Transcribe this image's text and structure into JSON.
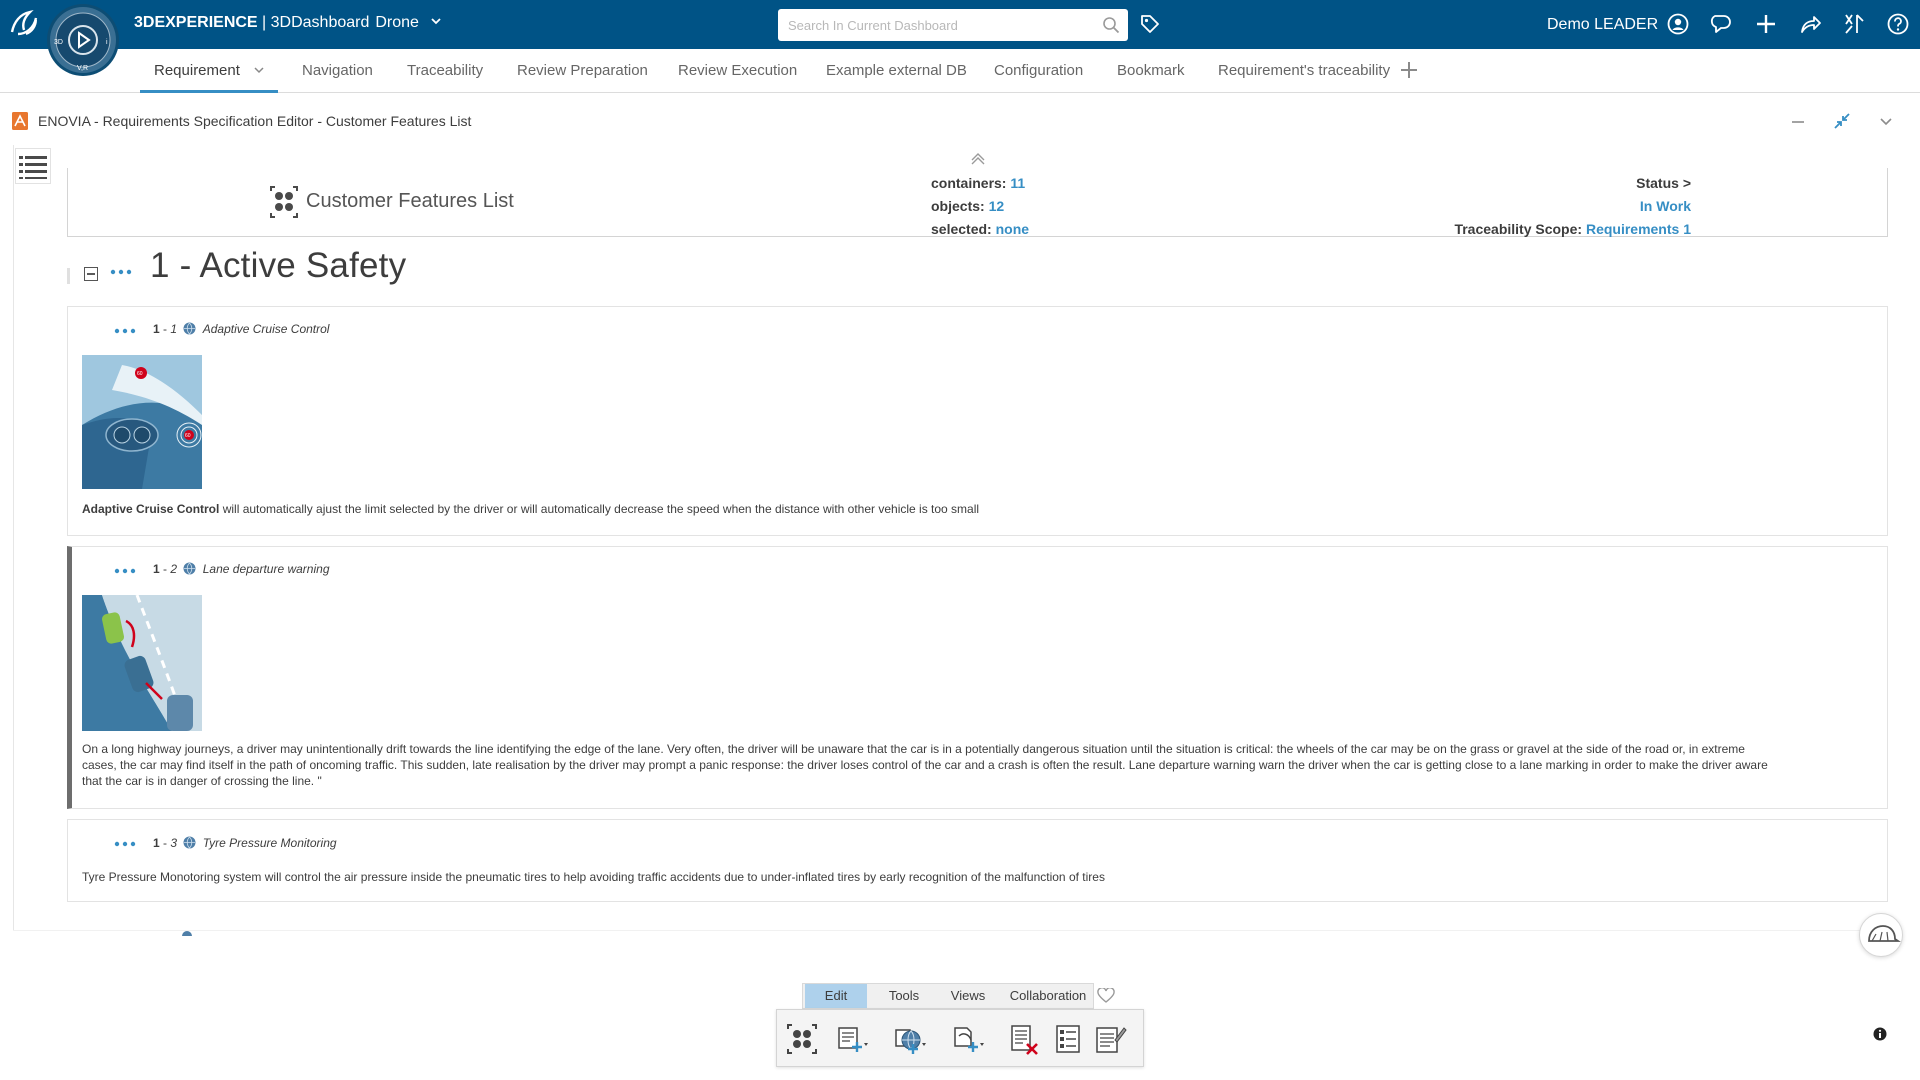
{
  "topbar": {
    "brand": "3DEXPERIENCE",
    "separator": " | ",
    "app": "3DDashboard",
    "context": "Drone",
    "search_placeholder": "Search In Current Dashboard",
    "user": "Demo LEADER",
    "bg_color": "#005386"
  },
  "tabs": [
    {
      "label": "Requirement",
      "active": true
    },
    {
      "label": "Navigation"
    },
    {
      "label": "Traceability"
    },
    {
      "label": "Review Preparation"
    },
    {
      "label": "Review Execution"
    },
    {
      "label": "Example external DB"
    },
    {
      "label": "Configuration"
    },
    {
      "label": "Bookmark"
    },
    {
      "label": "Requirement's traceability"
    }
  ],
  "widget": {
    "title": "ENOVIA - Requirements Specification Editor - Customer Features List"
  },
  "summary": {
    "spec_title": "Customer Features List",
    "containers_label": "containers: ",
    "containers_value": "11",
    "objects_label": "objects: ",
    "objects_value": "12",
    "selected_label": "selected: ",
    "selected_value": "none",
    "status_label": "Status >",
    "status_value": "In Work",
    "scope_label": "Traceability Scope: ",
    "scope_value": "Requirements 1"
  },
  "chapter": {
    "title": "1 - Active Safety"
  },
  "requirements": [
    {
      "num": "1",
      "sep": " - ",
      "sub": "1",
      "name": "Adaptive Cruise Control",
      "text_bold": "Adaptive Cruise Control",
      "text": " will automatically ajust the limit selected by the driver or will automatically decrease the speed when the distance with other vehicle is too small"
    },
    {
      "num": "1",
      "sep": " - ",
      "sub": "2",
      "name": "Lane departure warning",
      "text": "On a long highway journeys, a driver may unintentionally drift towards the line identifying the edge of the lane. Very often, the driver will be unaware that the car is in a potentially dangerous situation until the situation is critical: the wheels of the car may be on the grass or gravel at the side of the road or, in extreme cases, the car may find itself in the path of oncoming traffic. This sudden, late realisation by the driver may prompt a panic response: the driver loses control of the car and a crash is often the result. Lane departure warning  warn the driver when the car is getting close to a lane marking in order to make the driver aware that the car is in danger of crossing the line. \""
    },
    {
      "num": "1",
      "sep": " - ",
      "sub": "3",
      "name": "Tyre Pressure Monitoring",
      "text": "Tyre Pressure Monotoring system will control the air pressure inside the pneumatic tires to help avoiding traffic accidents due to under-inflated tires by early recognition of the malfunction of tires"
    }
  ],
  "toolbar": {
    "tabs": [
      "Edit",
      "Tools",
      "Views",
      "Collaboration"
    ],
    "active_tab": "Edit"
  },
  "colors": {
    "accent": "#368ec4",
    "selected_tab": "#aed1ec"
  }
}
